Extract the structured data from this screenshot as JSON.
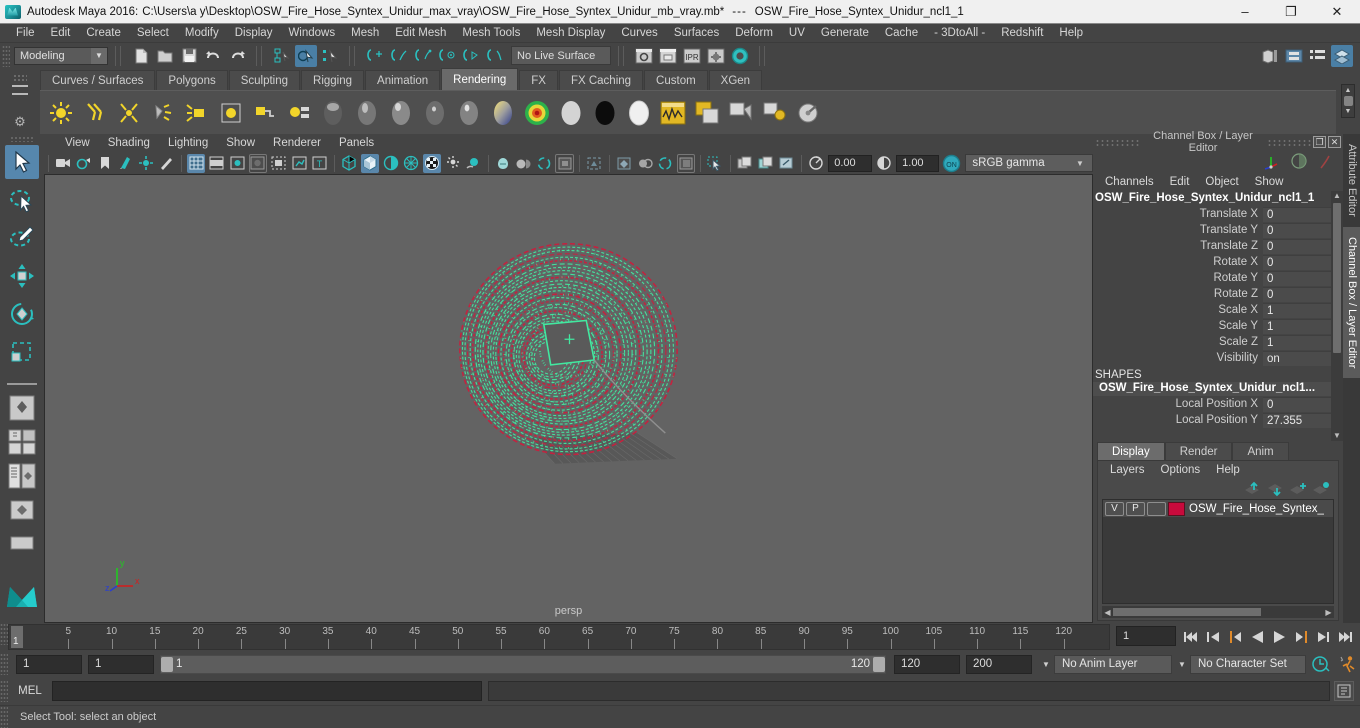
{
  "titlebar": {
    "app_title": "Autodesk Maya 2016:",
    "file_path": "C:\\Users\\a y\\Desktop\\OSW_Fire_Hose_Syntex_Unidur_max_vray\\OSW_Fire_Hose_Syntex_Unidur_mb_vray.mb*",
    "separator": "---",
    "selected_node": "OSW_Fire_Hose_Syntex_Unidur_ncl1_1",
    "minimize": "–",
    "restore": "❐",
    "close": "✕"
  },
  "menubar": {
    "items": [
      "File",
      "Edit",
      "Create",
      "Select",
      "Modify",
      "Display",
      "Windows",
      "Mesh",
      "Edit Mesh",
      "Mesh Tools",
      "Mesh Display",
      "Curves",
      "Surfaces",
      "Deform",
      "UV",
      "Generate",
      "Cache",
      "- 3DtoAll -",
      "Redshift",
      "Help"
    ]
  },
  "statusline": {
    "menuset": "Modeling",
    "live_surface": "No Live Surface",
    "icons": [
      "new-scene-icon",
      "open-scene-icon",
      "save-scene-icon",
      "undo-icon",
      "redo-icon",
      "select-by-hierarchy-icon",
      "select-by-object-icon",
      "select-by-component-icon",
      "snap-to-grid-icon",
      "snap-to-curve-icon",
      "snap-to-point-icon",
      "snap-to-projected-center-icon",
      "snap-to-view-plane-icon",
      "make-live-icon",
      "render-current-frame-icon",
      "ipr-render-icon",
      "render-settings-icon",
      "hypershade-icon",
      "render-view-icon",
      "show-hide-attribute-editor-icon",
      "show-hide-tool-settings-icon",
      "show-hide-channel-box-icon",
      "show-hide-layer-editor-icon"
    ]
  },
  "shelf": {
    "tabs": [
      "Curves / Surfaces",
      "Polygons",
      "Sculpting",
      "Rigging",
      "Animation",
      "Rendering",
      "FX",
      "FX Caching",
      "Custom",
      "XGen"
    ],
    "active_tab": "Rendering",
    "buttons": [
      "ambient-light-icon",
      "directional-light-icon",
      "point-light-icon",
      "spot-light-icon",
      "area-light-icon",
      "volume-light-icon",
      "light-linking-icon",
      "shading-group-icon",
      "ambient-material-icon",
      "anisotropic-material-icon",
      "blinn-material-icon",
      "lambert-material-icon",
      "phong-material-icon",
      "ramp-shader-icon",
      "ramp-texture-icon",
      "surface-shader-icon",
      "use-background-icon",
      "layered-shader-icon",
      "hypershade-icon",
      "render-view-icon",
      "batch-render-icon",
      "ipr-render-icon",
      "render-settings-icon"
    ]
  },
  "toolbox": {
    "tools": [
      {
        "name": "select-tool",
        "selected": true
      },
      {
        "name": "lasso-select-tool",
        "selected": false
      },
      {
        "name": "paint-select-tool",
        "selected": false
      },
      {
        "name": "move-tool",
        "selected": false
      },
      {
        "name": "rotate-tool",
        "selected": false
      },
      {
        "name": "scale-tool",
        "selected": false
      }
    ],
    "layouts": [
      "single-perspective-layout",
      "four-view-layout",
      "outliner-persp-layout",
      "hypershade-persp-layout",
      "persp-graph-layout"
    ]
  },
  "viewport": {
    "panel_menu": [
      "View",
      "Shading",
      "Lighting",
      "Show",
      "Renderer",
      "Panels"
    ],
    "exposure_value": "0.00",
    "gamma_value": "1.00",
    "color_management": "sRGB gamma",
    "color_management_toggle": "ON",
    "camera_label": "persp",
    "axis_x": "x",
    "axis_y": "y",
    "axis_z": "z",
    "toolbar_icons": [
      "select-camera-icon",
      "camera-attributes-icon",
      "bookmark-icon",
      "image-plane-icon",
      "two-d-pan-zoom-icon",
      "grease-pencil-icon",
      "grid-icon",
      "film-gate-icon",
      "resolution-gate-icon",
      "gate-mask-icon",
      "film-origin-icon",
      "safe-action-icon",
      "title-safe-icon",
      "wireframe-icon",
      "smooth-shade-all-icon",
      "shaded-wireframe-icon",
      "textured-icon",
      "use-all-lights-icon",
      "shadows-icon",
      "screen-space-ao-icon",
      "motion-blur-icon",
      "multisample-icon",
      "depth-of-field-icon",
      "isolate-select-icon",
      "xray-icon",
      "xray-joints-icon",
      "xray-active-components-icon",
      "exposure-icon",
      "gamma-icon"
    ],
    "model": {
      "name": "coiled-fire-hose",
      "wireframe_color": "#42e8a0",
      "highlight_color": "#c91f3d",
      "background_color": "#636363"
    }
  },
  "channel_box": {
    "panel_title": "Channel Box / Layer Editor",
    "menus": [
      "Channels",
      "Edit",
      "Object",
      "Show"
    ],
    "object_name": "OSW_Fire_Hose_Syntex_Unidur_ncl1_1",
    "transform_channels": [
      {
        "label": "Translate X",
        "value": "0"
      },
      {
        "label": "Translate Y",
        "value": "0"
      },
      {
        "label": "Translate Z",
        "value": "0"
      },
      {
        "label": "Rotate X",
        "value": "0"
      },
      {
        "label": "Rotate Y",
        "value": "0"
      },
      {
        "label": "Rotate Z",
        "value": "0"
      },
      {
        "label": "Scale X",
        "value": "1"
      },
      {
        "label": "Scale Y",
        "value": "1"
      },
      {
        "label": "Scale Z",
        "value": "1"
      },
      {
        "label": "Visibility",
        "value": "on"
      }
    ],
    "shapes_header": "SHAPES",
    "shape_name": "OSW_Fire_Hose_Syntex_Unidur_ncl1...",
    "shape_channels": [
      {
        "label": "Local Position X",
        "value": "0"
      },
      {
        "label": "Local Position Y",
        "value": "27.355"
      }
    ]
  },
  "layer_editor": {
    "tabs": [
      "Display",
      "Render",
      "Anim"
    ],
    "active_tab": "Display",
    "menus": [
      "Layers",
      "Options",
      "Help"
    ],
    "tool_icons": [
      "move-layer-up-icon",
      "move-layer-down-icon",
      "new-layer-icon",
      "new-layer-from-selected-icon"
    ],
    "layers": [
      {
        "visibility": "V",
        "playback": "P",
        "type": "",
        "color": "#c80a3c",
        "name": "OSW_Fire_Hose_Syntex_"
      }
    ]
  },
  "vertical_tabs": {
    "items": [
      "Attribute Editor",
      "Channel Box / Layer Editor"
    ],
    "active": "Channel Box / Layer Editor"
  },
  "timeline": {
    "ticks": [
      5,
      10,
      15,
      20,
      25,
      30,
      35,
      40,
      45,
      50,
      55,
      60,
      65,
      70,
      75,
      80,
      85,
      90,
      95,
      100,
      105,
      110,
      115,
      120
    ],
    "current_frame": "1",
    "current_frame_field": "1",
    "playback_buttons": [
      "go-to-start-icon",
      "step-back-frame-icon",
      "step-back-key-icon",
      "play-backwards-icon",
      "play-forwards-icon",
      "step-forward-key-icon",
      "step-forward-frame-icon",
      "go-to-end-icon"
    ]
  },
  "range": {
    "anim_start": "1",
    "range_start": "1",
    "range_bar_start": "1",
    "range_bar_end": "120",
    "range_end": "120",
    "anim_end": "200",
    "anim_layer": "No Anim Layer",
    "character_set": "No Character Set",
    "anim_pref_icon": "animation-preferences-icon",
    "anim_run_icon": "auto-key-icon"
  },
  "command_line": {
    "language": "MEL",
    "input_value": "",
    "output_value": "",
    "script_editor_icon": "script-editor-icon"
  },
  "helpline": {
    "text": "Select Tool: select an object"
  }
}
